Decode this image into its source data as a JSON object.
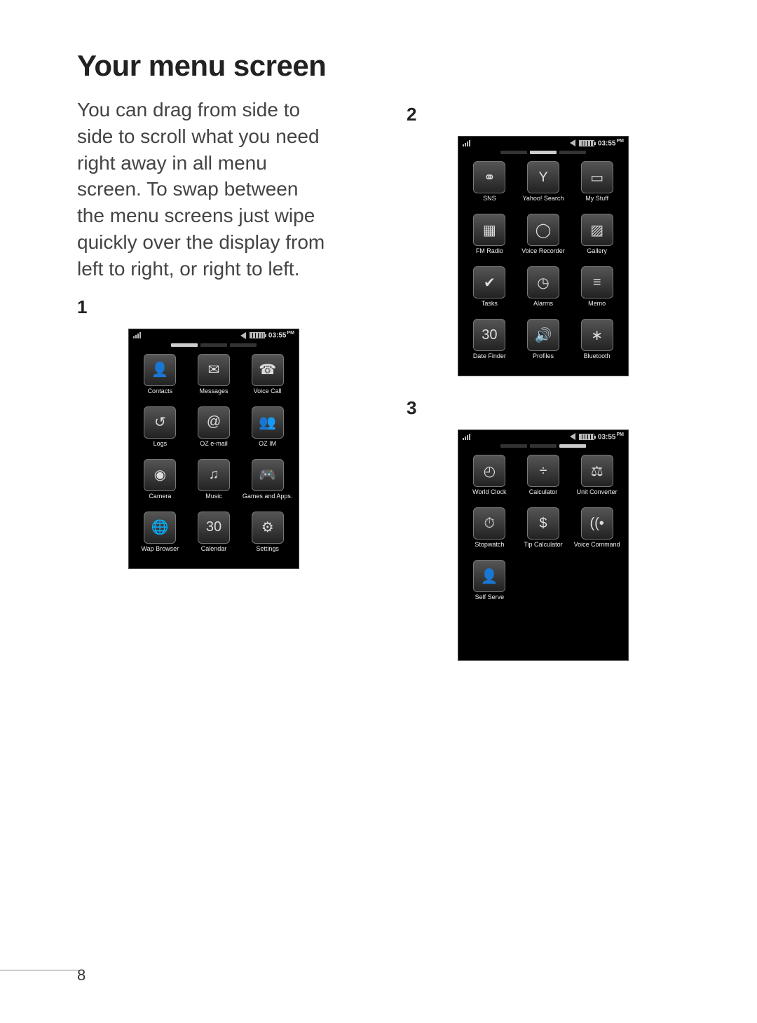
{
  "heading": "Your menu screen",
  "intro": "You can drag from side to side to scroll what you need right away in all menu screen. To swap between the menu screens just wipe quickly over the display from left to right, or right to left.",
  "page_number": "8",
  "status_time": "03:55",
  "status_ampm": "PM",
  "screens": [
    {
      "num": "1",
      "page_active": 0,
      "apps": [
        {
          "label": "Contacts",
          "glyph": "👤"
        },
        {
          "label": "Messages",
          "glyph": "✉"
        },
        {
          "label": "Voice Call",
          "glyph": "☎"
        },
        {
          "label": "Logs",
          "glyph": "↺"
        },
        {
          "label": "OZ e-mail",
          "glyph": "@"
        },
        {
          "label": "OZ IM",
          "glyph": "👥"
        },
        {
          "label": "Camera",
          "glyph": "◉"
        },
        {
          "label": "Music",
          "glyph": "♫"
        },
        {
          "label": "Games and Apps.",
          "glyph": "🎮"
        },
        {
          "label": "Wap Browser",
          "glyph": "🌐"
        },
        {
          "label": "Calendar",
          "glyph": "30"
        },
        {
          "label": "Settings",
          "glyph": "⚙"
        }
      ]
    },
    {
      "num": "2",
      "page_active": 1,
      "apps": [
        {
          "label": "SNS",
          "glyph": "⚭"
        },
        {
          "label": "Yahoo! Search",
          "glyph": "Y"
        },
        {
          "label": "My Stuff",
          "glyph": "▭"
        },
        {
          "label": "FM Radio",
          "glyph": "▦"
        },
        {
          "label": "Voice Recorder",
          "glyph": "◯"
        },
        {
          "label": "Gallery",
          "glyph": "▨"
        },
        {
          "label": "Tasks",
          "glyph": "✔"
        },
        {
          "label": "Alarms",
          "glyph": "◷"
        },
        {
          "label": "Memo",
          "glyph": "≡"
        },
        {
          "label": "Date Finder",
          "glyph": "30"
        },
        {
          "label": "Profiles",
          "glyph": "🔊"
        },
        {
          "label": "Bluetooth",
          "glyph": "∗"
        }
      ]
    },
    {
      "num": "3",
      "page_active": 2,
      "apps": [
        {
          "label": "World Clock",
          "glyph": "◴"
        },
        {
          "label": "Calculator",
          "glyph": "÷"
        },
        {
          "label": "Unit Converter",
          "glyph": "⚖"
        },
        {
          "label": "Stopwatch",
          "glyph": "⏱"
        },
        {
          "label": "Tip Calculator",
          "glyph": "$"
        },
        {
          "label": "Voice Command",
          "glyph": "((•"
        },
        {
          "label": "Self Serve",
          "glyph": "👤"
        }
      ]
    }
  ]
}
